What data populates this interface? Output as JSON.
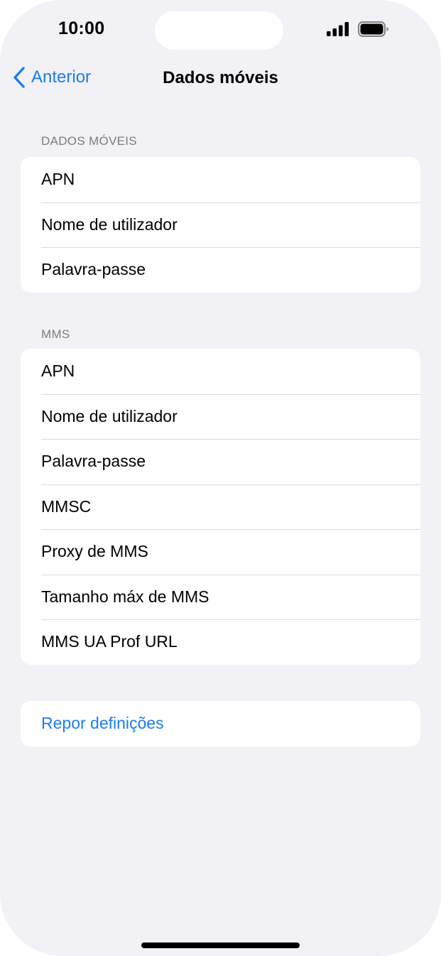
{
  "status_bar": {
    "time": "10:00"
  },
  "nav": {
    "back_label": "Anterior",
    "title": "Dados móveis"
  },
  "sections": {
    "mobile_data": {
      "header": "DADOS MÓVEIS",
      "rows": [
        "APN",
        "Nome de utilizador",
        "Palavra-passe"
      ]
    },
    "mms": {
      "header": "MMS",
      "rows": [
        "APN",
        "Nome de utilizador",
        "Palavra-passe",
        "MMSC",
        "Proxy de MMS",
        "Tamanho máx de MMS",
        "MMS UA Prof URL"
      ]
    },
    "reset": {
      "label": "Repor definições"
    }
  },
  "colors": {
    "accent": "#1c7cf0",
    "background": "#f1f1f6",
    "secondary_text": "#7b7b80"
  },
  "icons": {
    "back": "chevron-left-icon",
    "signal": "cellular-signal-icon",
    "battery": "battery-icon"
  }
}
